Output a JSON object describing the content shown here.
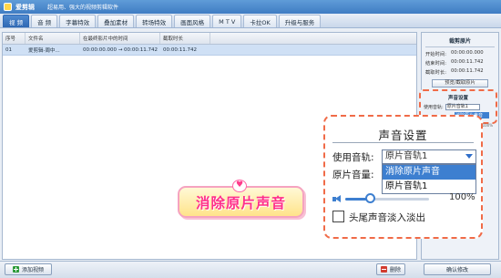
{
  "window": {
    "app_name": "爱剪辑",
    "slogan": "超易用、强大的视频剪辑软件"
  },
  "tabs": [
    {
      "label": "视 频",
      "active": true
    },
    {
      "label": "音 频",
      "active": false
    },
    {
      "label": "字幕特效",
      "active": false
    },
    {
      "label": "叠加素材",
      "active": false
    },
    {
      "label": "转场特效",
      "active": false
    },
    {
      "label": "画面风格",
      "active": false
    },
    {
      "label": "M T V",
      "active": false
    },
    {
      "label": "卡拉OK",
      "active": false
    },
    {
      "label": "升级与服务",
      "active": false
    }
  ],
  "video_table": {
    "headers": [
      "序号",
      "文件名",
      "在最终影片中的时间",
      "截取时长",
      ""
    ],
    "rows": [
      {
        "index": "01",
        "filename": "爱剪辑-周中...",
        "final_time": "00:00:00.000 → 00:00:11.742",
        "duration": "00:00:11.742"
      }
    ]
  },
  "right_panel": {
    "clip_title": "裁剪原片",
    "start_label": "开始时间:",
    "start_value": "00:00:00.000",
    "end_label": "结束时间:",
    "end_value": "00:00:11.742",
    "duration_label": "截取时长:",
    "duration_value": "00:00:11.742",
    "preview_button": "预览/截取原片",
    "sound_title": "声音设置",
    "track_label": "使用音轨:",
    "track_value": "原片音轨1",
    "highlight_option": "消除原片声音",
    "volume_pct": "100%"
  },
  "sound_callout": {
    "title": "声音设置",
    "track_label": "使用音轨:",
    "track_value": "原片音轨1",
    "volume_label": "原片音量:",
    "options": [
      "消除原片声音",
      "原片音轨1"
    ],
    "selected_option": "消除原片声音",
    "volume_value": "100%",
    "volume_level": 0.3,
    "fade_label": "头尾声音淡入淡出",
    "fade_checked": false
  },
  "banner": {
    "text": "消除原片声音"
  },
  "bottom_bar": {
    "add_video": "添加视频",
    "delete": "删除",
    "confirm": "确认修改"
  },
  "colors": {
    "accent_blue": "#3d7fd0",
    "callout_orange": "#f06b48",
    "banner_pink": "#ff2f8a"
  }
}
